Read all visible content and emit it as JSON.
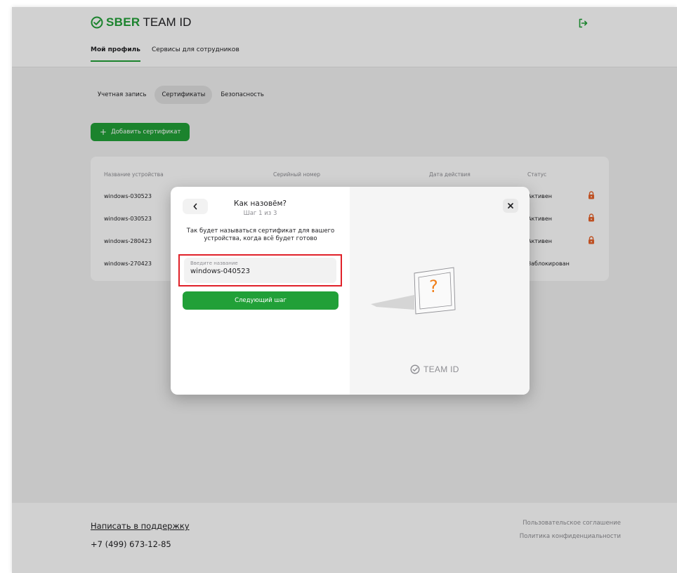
{
  "brand": {
    "sber": "SBER",
    "team_id": "TEAM ID",
    "accent": "#21a038"
  },
  "header": {
    "nav": [
      {
        "label": "Мой профиль",
        "active": true
      },
      {
        "label": "Сервисы для сотрудников",
        "active": false
      }
    ],
    "logout_icon": "logout-icon"
  },
  "subtabs": [
    {
      "label": "Учетная запись",
      "active": false
    },
    {
      "label": "Сертификаты",
      "active": true
    },
    {
      "label": "Безопасность",
      "active": false
    }
  ],
  "add_button": {
    "label": "Добавить сертификат",
    "icon": "plus-icon"
  },
  "table": {
    "columns": [
      "Название устройства",
      "Серийный номер",
      "Дата действия",
      "Статус"
    ],
    "rows": [
      {
        "device": "windows-030523",
        "status": "Активен",
        "locked": true
      },
      {
        "device": "windows-030523",
        "status": "Активен",
        "locked": true
      },
      {
        "device": "windows-280423",
        "status": "Активен",
        "locked": true
      },
      {
        "device": "windows-270423",
        "status": "Заблокирован",
        "locked": false
      }
    ]
  },
  "footer": {
    "support_link": "Написать в поддержку",
    "phone": "+7 (499) 673-12-85",
    "links": [
      "Пользовательское соглашение",
      "Политика конфиденциальности"
    ]
  },
  "modal": {
    "title": "Как назовём?",
    "step": "Шаг 1 из 3",
    "description": "Так будет называться сертификат для вашего устройства, когда всё будет готово",
    "field_label": "Введите название",
    "field_value": "windows-040523",
    "next_button": "Следующий шаг",
    "question_mark": "?",
    "illustration_brand": "TEAM ID",
    "highlight_color": "#e02129"
  }
}
